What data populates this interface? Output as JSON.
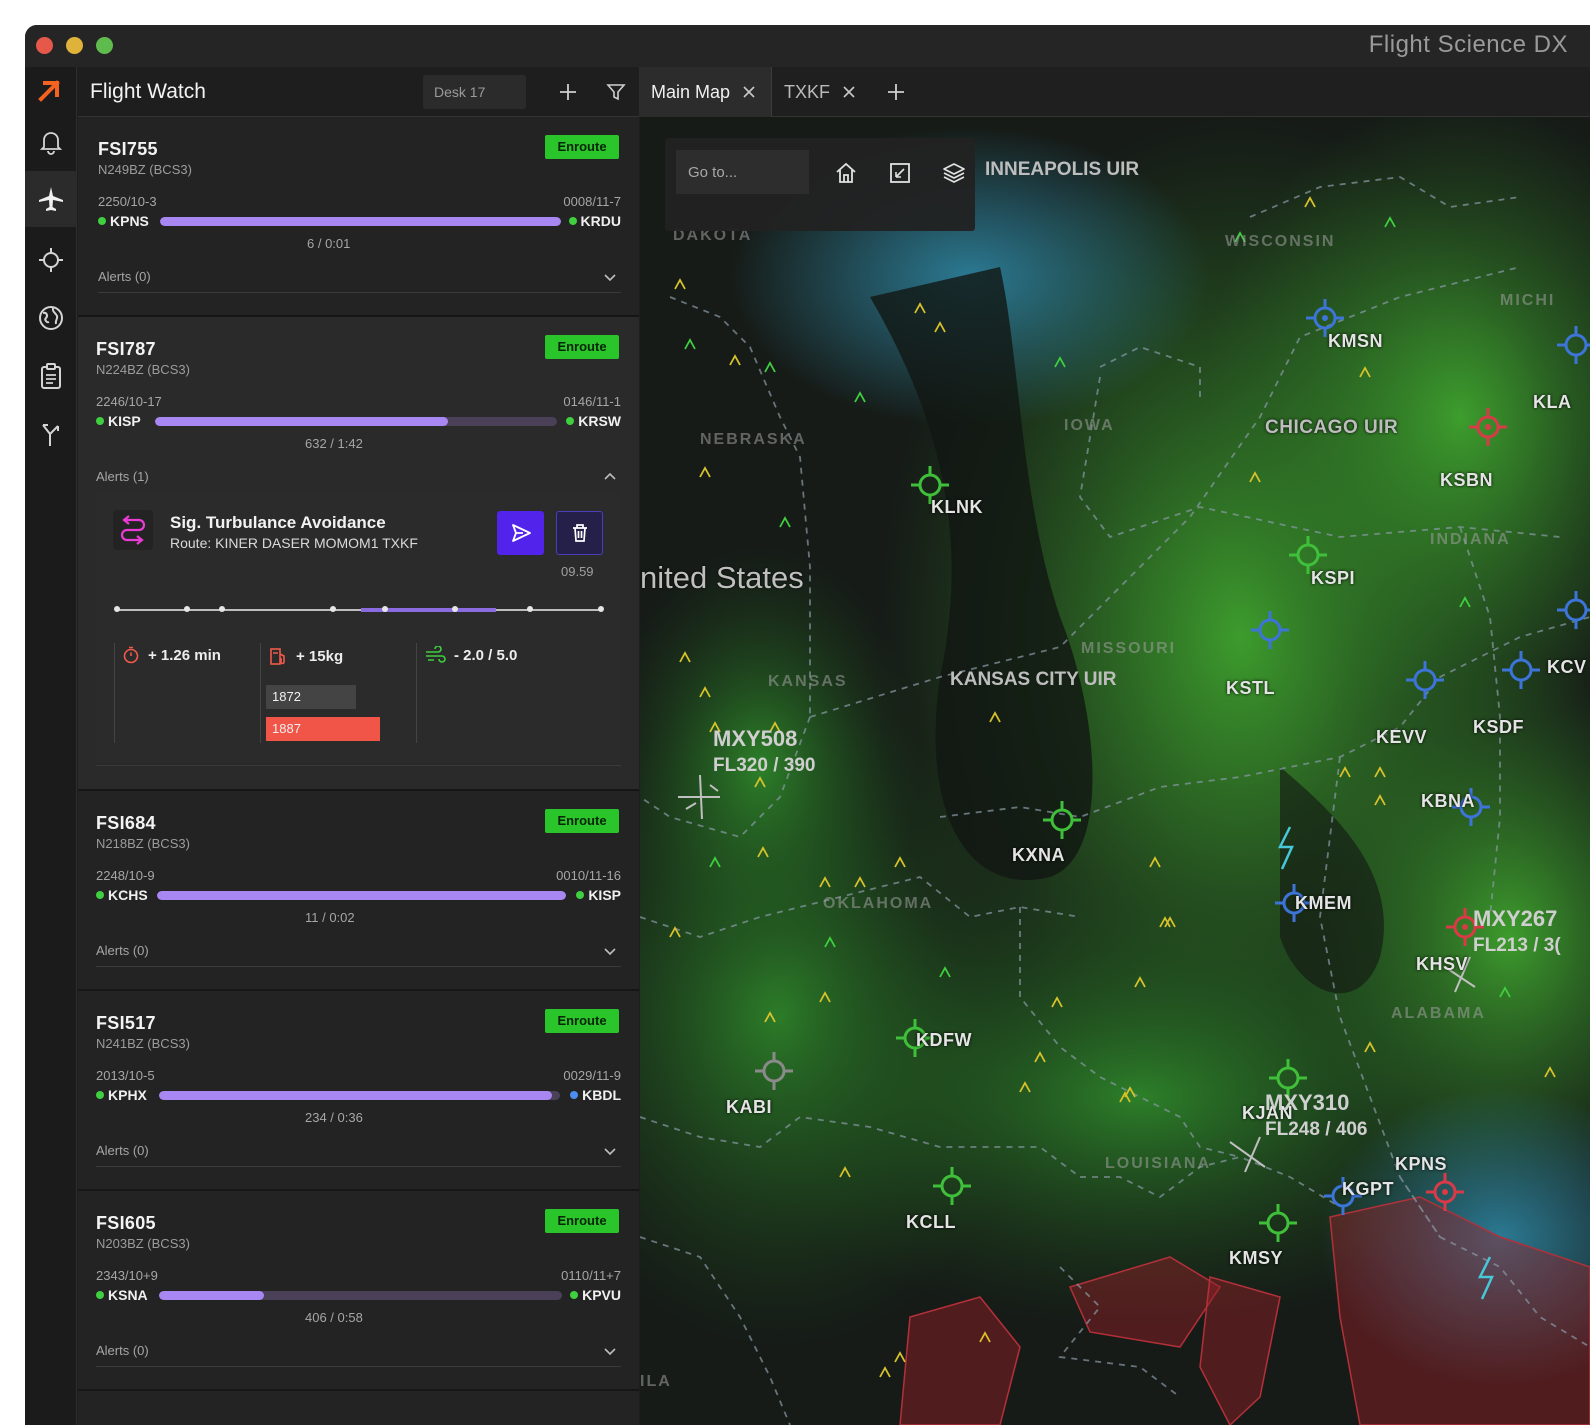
{
  "window": {
    "title": "Flight Science DX"
  },
  "panel": {
    "title": "Flight Watch",
    "desk": "Desk 17"
  },
  "tabs": [
    {
      "label": "Main Map"
    },
    {
      "label": "TXKF"
    }
  ],
  "map": {
    "goto_placeholder": "Go to...",
    "airports": [
      "KMSN",
      "KLA",
      "CHICAGO UIR",
      "KSBN",
      "KLNK",
      "KSPI",
      "KSTL",
      "KCV",
      "KEVV",
      "KSDF",
      "KBNA",
      "KXNA",
      "KMEM",
      "KHSV",
      "KDFW",
      "KABI",
      "KJAN",
      "KPNS",
      "KGPT",
      "KCLL",
      "KMSY"
    ],
    "regions": [
      "DAKOTA",
      "WISCONSIN",
      "MICHI",
      "NEBRASKA",
      "IOWA",
      "INDIANA",
      "MISSOURI",
      "KANSAS",
      "OKLAHOMA",
      "ALABAMA",
      "LOUISIANA",
      "ILA"
    ],
    "uirs": [
      "INNEAPOLIS UIR",
      "KANSAS CITY UIR"
    ],
    "country": "nited States",
    "flights": [
      {
        "id": "MXY508",
        "fl": "FL320 / 390"
      },
      {
        "id": "MXY267",
        "fl": "FL213 / 3("
      },
      {
        "id": "MXY310",
        "fl": "FL248 / 406"
      }
    ]
  },
  "flights": [
    {
      "id": "FSI755",
      "reg": "N249BZ (BCS3)",
      "status": "Enroute",
      "dep_time": "2250/10-3",
      "arr_time": "0008/11-7",
      "origin": "KPNS",
      "dest": "KRDU",
      "origin_color": "#3fcf3f",
      "dest_color": "#3fcf3f",
      "progress": 1.0,
      "progress_text": "6 /   0:01",
      "alerts": "Alerts (0)"
    },
    {
      "id": "FSI787",
      "reg": "N224BZ (BCS3)",
      "status": "Enroute",
      "dep_time": "2246/10-17",
      "arr_time": "0146/11-1",
      "origin": "KISP",
      "dest": "KRSW",
      "origin_color": "#3fcf3f",
      "dest_color": "#3fcf3f",
      "progress": 0.73,
      "progress_text": "632  /   1:42",
      "alerts": "Alerts (1)",
      "alert": {
        "title": "Sig. Turbulance Avoidance",
        "route": "Route: KINER DASER MOMOM1 TXKF",
        "time": "09.59",
        "time_delta": "+ 1.26 min",
        "fuel_delta": "+ 15kg",
        "wind": "- 2.0 / 5.0",
        "fuel_before": "1872",
        "fuel_after": "1887"
      }
    },
    {
      "id": "FSI684",
      "reg": "N218BZ (BCS3)",
      "status": "Enroute",
      "dep_time": "2248/10-9",
      "arr_time": "0010/11-16",
      "origin": "KCHS",
      "dest": "KISP",
      "origin_color": "#3fcf3f",
      "dest_color": "#3fcf3f",
      "progress": 1.0,
      "progress_text": "11 /   0:02",
      "alerts": "Alerts (0)"
    },
    {
      "id": "FSI517",
      "reg": "N241BZ (BCS3)",
      "status": "Enroute",
      "dep_time": "2013/10-5",
      "arr_time": "0029/11-9",
      "origin": "KPHX",
      "dest": "KBDL",
      "origin_color": "#3fcf3f",
      "dest_color": "#4a8ff0",
      "progress": 0.98,
      "progress_text": "234  /   0:36",
      "alerts": "Alerts (0)"
    },
    {
      "id": "FSI605",
      "reg": "N203BZ (BCS3)",
      "status": "Enroute",
      "dep_time": "2343/10+9",
      "arr_time": "0110/11+7",
      "origin": "KSNA",
      "dest": "KPVU",
      "origin_color": "#3fcf3f",
      "dest_color": "#3fcf3f",
      "progress": 0.26,
      "progress_text": "406  /   0:58",
      "alerts": "Alerts (0)"
    }
  ]
}
